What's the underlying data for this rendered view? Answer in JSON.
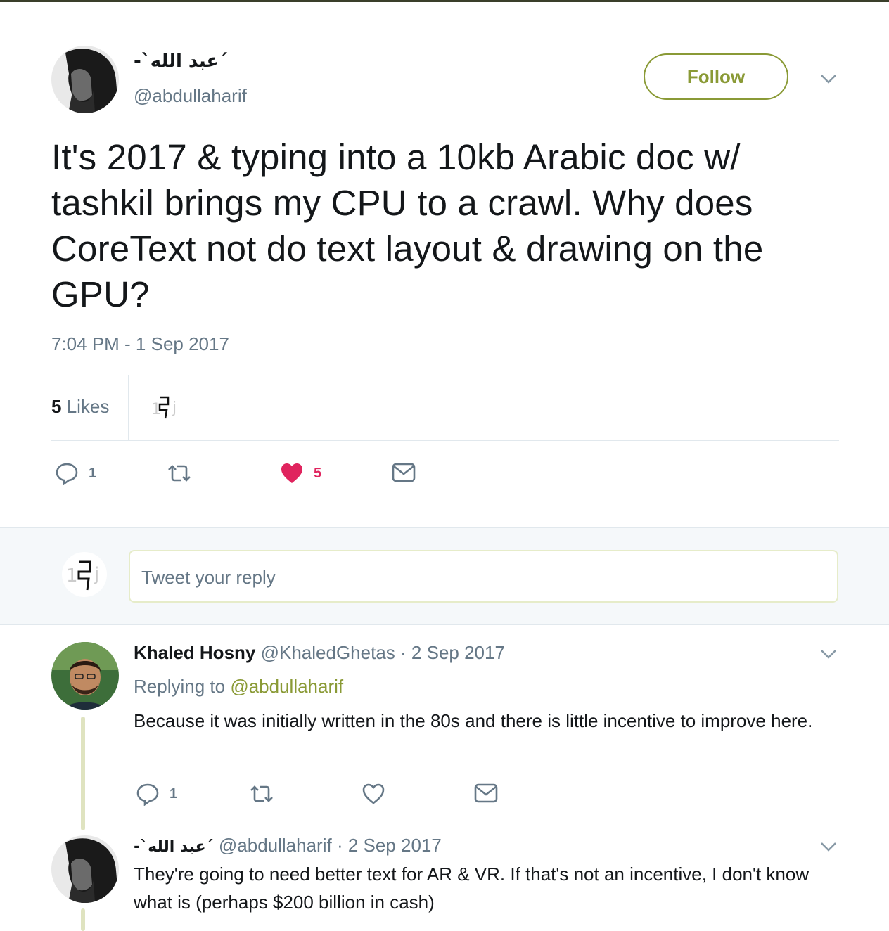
{
  "tweet": {
    "display_name": "-`عبد الله´",
    "handle": "@abdullaharif",
    "follow_label": "Follow",
    "text": "It's 2017 & typing into a 10kb Arabic doc w/ tashkil brings my CPU to a crawl. Why does CoreText not do text layout & drawing on the GPU?",
    "timestamp": "7:04 PM - 1 Sep 2017",
    "likes_number": "5",
    "likes_word": " Likes",
    "actions": {
      "reply_count": "1",
      "retweet_count": "",
      "like_count": "5"
    },
    "accent_color": "#8a9a36",
    "like_color": "#e0245e"
  },
  "reply_box": {
    "placeholder": "Tweet your reply"
  },
  "replies": [
    {
      "name": "Khaled Hosny",
      "handle": "@KhaledGhetas",
      "date": "· 2 Sep 2017",
      "replying_prefix": "Replying to ",
      "replying_handle": "@abdullaharif",
      "text": "Because it was initially written in the 80s and there is little incentive to improve here.",
      "reply_count": "1"
    },
    {
      "name": "-`عبد الله´",
      "handle": "@abdullaharif",
      "date": "· 2 Sep 2017",
      "text": "They're going to need better text for AR & VR. If that's not an incentive, I don't know what is (perhaps $200 billion in cash)"
    }
  ]
}
